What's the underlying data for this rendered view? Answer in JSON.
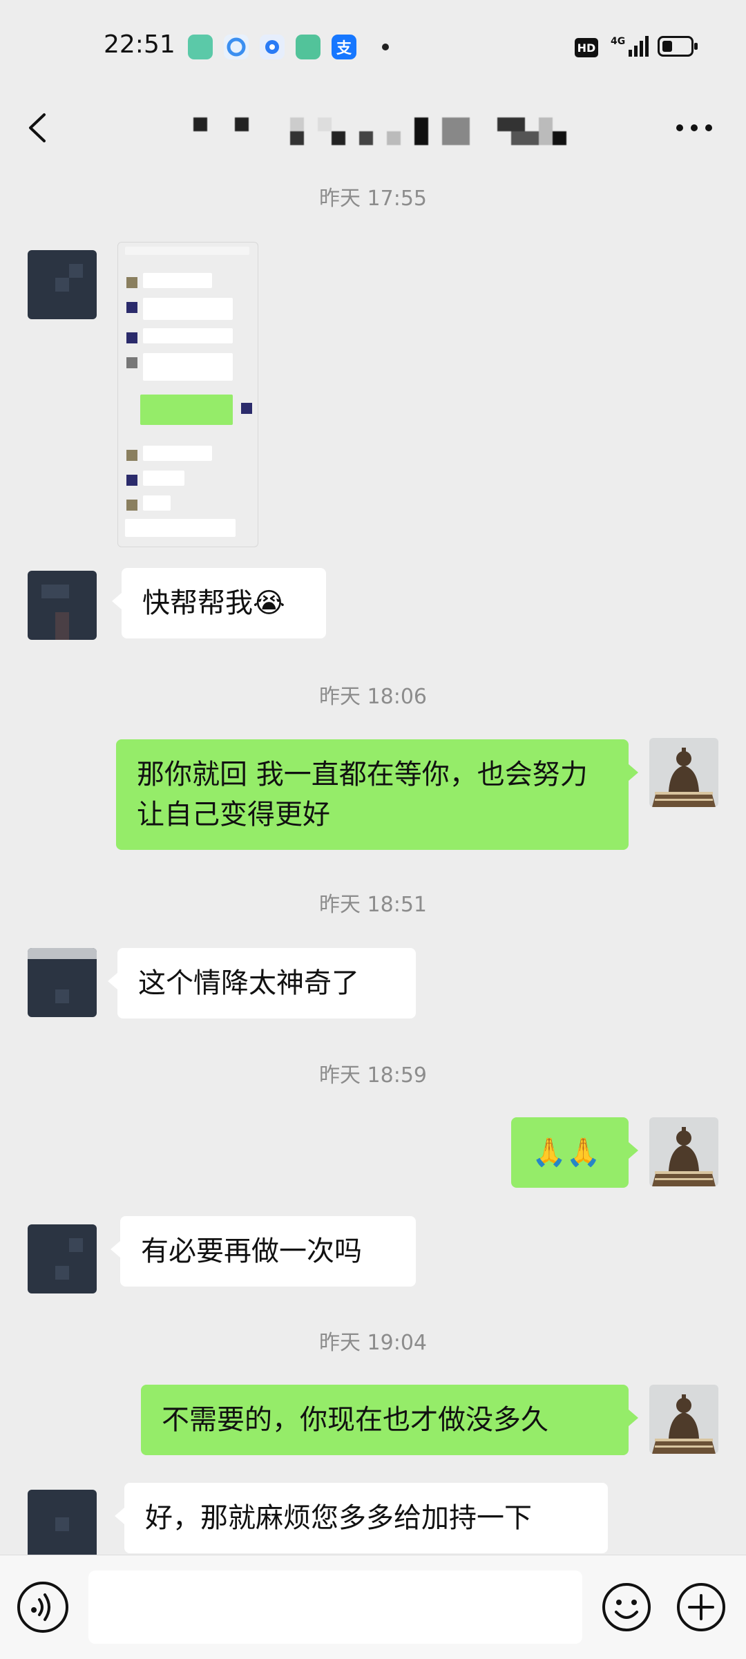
{
  "status_bar": {
    "time": "22:51",
    "network": "4G",
    "hd_label": "HD",
    "apps": [
      {
        "icon": "green-app-icon",
        "color": "#5bc9a8"
      },
      {
        "icon": "browser-icon",
        "color": "#3b8ff0"
      },
      {
        "icon": "blue-circle-app-icon",
        "color": "#2a7bf5"
      },
      {
        "icon": "green-cart-app-icon",
        "color": "#52c39a"
      },
      {
        "icon": "alipay-icon",
        "color": "#1677ff",
        "glyph": "支"
      }
    ]
  },
  "header": {
    "title_redacted": true
  },
  "messages": [
    {
      "type": "timestamp",
      "text": "昨天 17:55"
    },
    {
      "type": "image",
      "from": "peer",
      "description_hidden": true
    },
    {
      "type": "text",
      "from": "peer",
      "text": "快帮帮我😭"
    },
    {
      "type": "timestamp",
      "text": "昨天 18:06"
    },
    {
      "type": "text",
      "from": "self",
      "text": "那你就回 我一直都在等你，也会努力让自己变得更好"
    },
    {
      "type": "timestamp",
      "text": "昨天 18:51"
    },
    {
      "type": "text",
      "from": "peer",
      "text": "这个情降太神奇了"
    },
    {
      "type": "timestamp",
      "text": "昨天 18:59"
    },
    {
      "type": "text",
      "from": "self",
      "text": "🙏🙏"
    },
    {
      "type": "text",
      "from": "peer",
      "text": "有必要再做一次吗"
    },
    {
      "type": "timestamp",
      "text": "昨天 19:04"
    },
    {
      "type": "text",
      "from": "self",
      "text": "不需要的，你现在也才做没多久"
    },
    {
      "type": "text",
      "from": "peer",
      "text": "好，那就麻烦您多多给加持一下"
    }
  ],
  "input": {
    "value": "",
    "placeholder": ""
  },
  "colors": {
    "background": "#ededed",
    "bubble_self": "#95ec69",
    "bubble_peer": "#ffffff",
    "timestamp": "#8c8c8c"
  }
}
